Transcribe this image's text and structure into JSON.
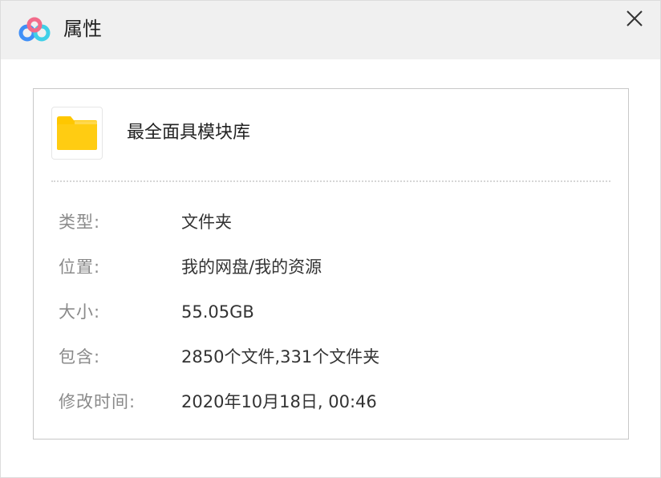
{
  "window": {
    "title": "属性",
    "close_icon": "close-icon"
  },
  "file": {
    "icon": "folder-icon",
    "name": "最全面具模块库"
  },
  "properties": [
    {
      "label": "类型:",
      "value": "文件夹"
    },
    {
      "label": "位置:",
      "value": "我的网盘/我的资源"
    },
    {
      "label": "大小:",
      "value": "55.05GB"
    },
    {
      "label": "包含:",
      "value": "2850个文件,331个文件夹"
    },
    {
      "label": "修改时间:",
      "value": "2020年10月18日, 00:46"
    }
  ],
  "colors": {
    "titlebar_bg": "#f0f0f0",
    "folder_yellow": "#ffc700",
    "label_gray": "#8a8a8a",
    "value_text": "#333333"
  }
}
